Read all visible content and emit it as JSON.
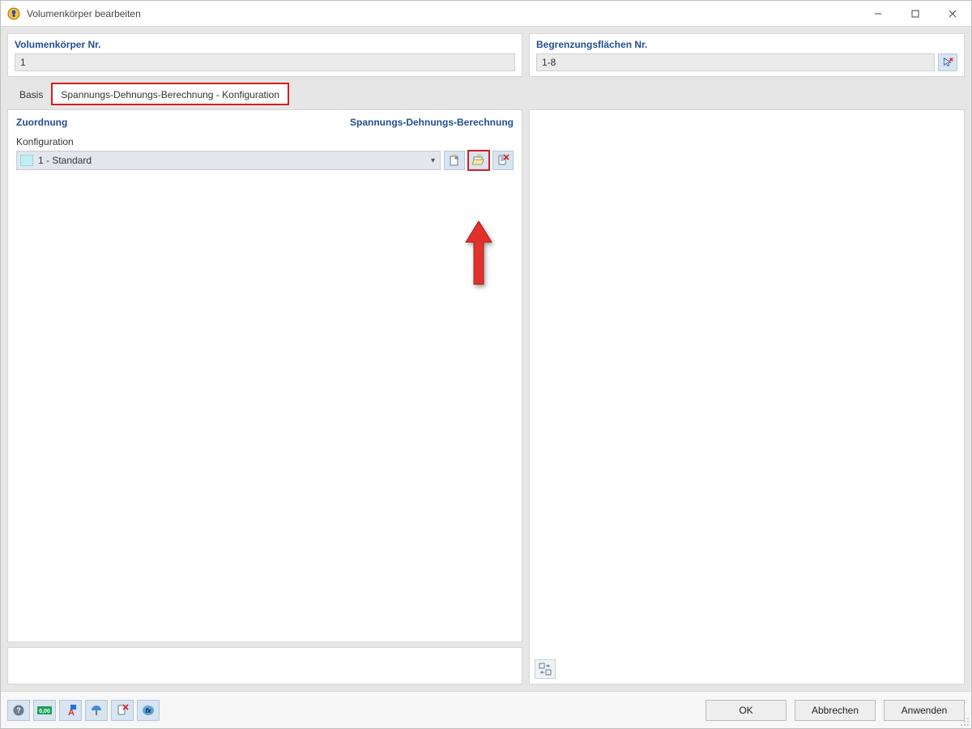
{
  "window": {
    "title": "Volumenkörper bearbeiten"
  },
  "top": {
    "left_label": "Volumenkörper Nr.",
    "left_value": "1",
    "right_label": "Begrenzungsflächen Nr.",
    "right_value": "1-8"
  },
  "tabs": {
    "basis": "Basis",
    "config": "Spannungs-Dehnungs-Berechnung - Konfiguration"
  },
  "main": {
    "section_left": "Zuordnung",
    "section_right": "Spannungs-Dehnungs-Berechnung",
    "field_label": "Konfiguration",
    "combo_value": "1 - Standard"
  },
  "buttons": {
    "ok": "OK",
    "cancel": "Abbrechen",
    "apply": "Anwenden"
  }
}
